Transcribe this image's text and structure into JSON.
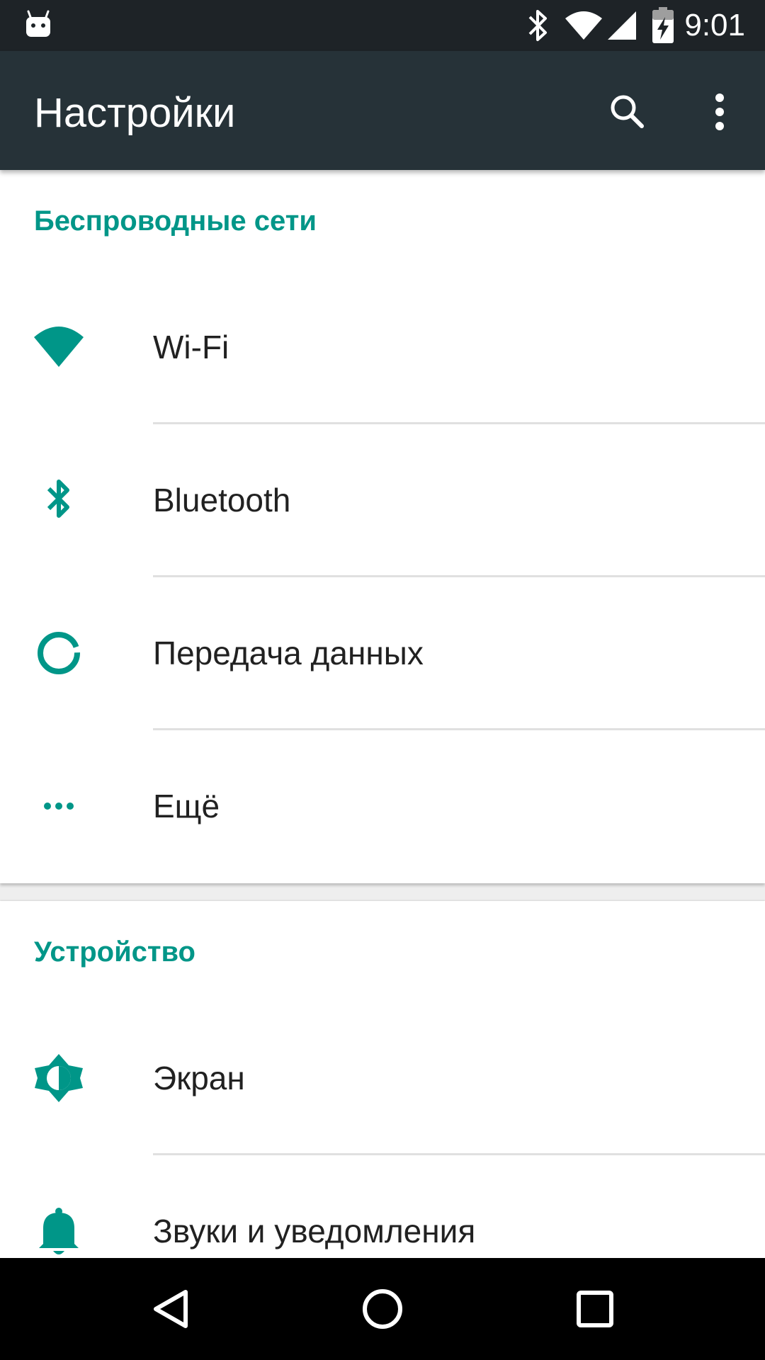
{
  "status_bar": {
    "time": "9:01",
    "left_icon": "android-debug-icon",
    "icons": [
      "bluetooth-icon",
      "wifi-signal-icon",
      "cell-signal-icon",
      "battery-charging-icon"
    ]
  },
  "toolbar": {
    "title": "Настройки",
    "search_icon": "search-icon",
    "more_icon": "more-vert-icon"
  },
  "sections": [
    {
      "header": "Беспроводные сети",
      "items": [
        {
          "label": "Wi-Fi",
          "icon": "wifi-icon"
        },
        {
          "label": "Bluetooth",
          "icon": "bluetooth-icon"
        },
        {
          "label": "Передача данных",
          "icon": "data-usage-icon"
        },
        {
          "label": "Ещё",
          "icon": "more-horiz-icon"
        }
      ]
    },
    {
      "header": "Устройство",
      "items": [
        {
          "label": "Экран",
          "icon": "brightness-icon"
        },
        {
          "label": "Звуки и уведомления",
          "icon": "bell-icon"
        }
      ]
    }
  ],
  "nav_bar": {
    "buttons": [
      "back-icon",
      "home-icon",
      "recents-icon"
    ]
  },
  "colors": {
    "accent": "#009688",
    "toolbar": "#263238",
    "status_bar": "#1e2327"
  }
}
